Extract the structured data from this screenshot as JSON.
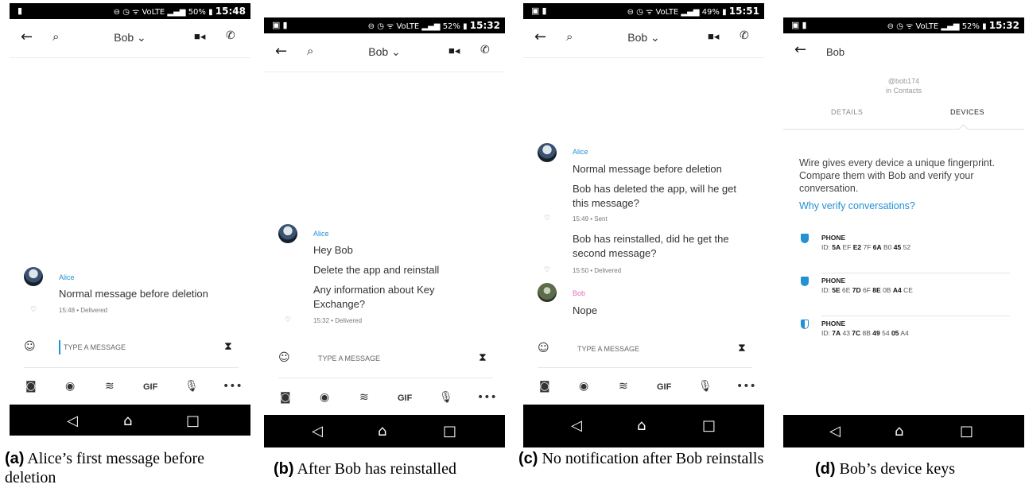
{
  "status": {
    "a": {
      "time": "15:48",
      "battery": "50%"
    },
    "b": {
      "time": "15:32",
      "battery": "52%"
    },
    "c": {
      "time": "15:51",
      "battery": "49%"
    },
    "d": {
      "time": "15:32",
      "battery": "52%"
    }
  },
  "conversation": {
    "title": "Bob ⌄"
  },
  "composer": {
    "placeholder": "TYPE A MESSAGE"
  },
  "toolbar": {
    "gif": "GIF"
  },
  "panel_a": {
    "sender": "Alice",
    "messages": [
      "Normal message before deletion"
    ],
    "meta": "15:48 • Delivered",
    "caption_label": "(a)",
    "caption_text": "Alice’s first message before deletion"
  },
  "panel_b": {
    "sender": "Alice",
    "messages": [
      "Hey Bob",
      "Delete the app and reinstall",
      "Any information about Key Exchange?"
    ],
    "meta": "15:32 • Delivered",
    "caption_label": "(b)",
    "caption_text": "After Bob has reinstalled"
  },
  "panel_c": {
    "sender": "Alice",
    "messages": [
      "Normal message before deletion",
      "Bob has deleted the app, will he get this message?",
      "Bob has reinstalled, did he get the second message?"
    ],
    "meta1": "15:49 • Sent",
    "meta2": "15:50 • Delivered",
    "sender2": "Bob",
    "reply": "Nope",
    "caption_label": "(c)",
    "caption_text": "No notification after Bob reinstalls"
  },
  "panel_d": {
    "title": "Bob",
    "handle": "@bob174",
    "handle_sub": "in Contacts",
    "tab_details": "DETAILS",
    "tab_devices": "DEVICES",
    "info": "Wire gives every device a unique fingerprint. Compare them with Bob and verify your conversation.",
    "link": "Why verify conversations?",
    "devices": [
      {
        "name": "PHONE",
        "id_parts": [
          [
            "ID: ",
            false
          ],
          [
            "5A",
            true
          ],
          [
            " EF ",
            false
          ],
          [
            "E2",
            true
          ],
          [
            " 7F ",
            false
          ],
          [
            "6A",
            true
          ],
          [
            " B0 ",
            false
          ],
          [
            "45",
            true
          ],
          [
            " 52",
            false
          ]
        ],
        "verified": "full"
      },
      {
        "name": "PHONE",
        "id_parts": [
          [
            "ID: ",
            false
          ],
          [
            "5E",
            true
          ],
          [
            " 6E ",
            false
          ],
          [
            "7D",
            true
          ],
          [
            " 6F ",
            false
          ],
          [
            "8E",
            true
          ],
          [
            " 0B ",
            false
          ],
          [
            "A4",
            true
          ],
          [
            " CE",
            false
          ]
        ],
        "verified": "full"
      },
      {
        "name": "PHONE",
        "id_parts": [
          [
            "ID: ",
            false
          ],
          [
            "7A",
            true
          ],
          [
            " 43 ",
            false
          ],
          [
            "7C",
            true
          ],
          [
            " 8B ",
            false
          ],
          [
            "49",
            true
          ],
          [
            " 54 ",
            false
          ],
          [
            "05",
            true
          ],
          [
            " A4",
            false
          ]
        ],
        "verified": "half"
      }
    ],
    "caption_label": "(d)",
    "caption_text": "Bob’s device keys"
  },
  "icons": {
    "back": "arrow-left-icon",
    "search": "search-icon",
    "video": "video-camera-icon",
    "call": "phone-icon",
    "emoji": "emoji-icon",
    "timer": "hourglass-icon",
    "camera": "camera-icon",
    "ping": "ping-icon",
    "sketch": "sketch-icon",
    "mic": "microphone-icon",
    "more": "more-icon",
    "nav_back": "nav-back-icon",
    "nav_home": "nav-home-icon",
    "nav_recent": "nav-recent-icon"
  },
  "colors": {
    "accent": "#2391d3",
    "bob": "#e36cbf",
    "navbar": "#000000"
  }
}
